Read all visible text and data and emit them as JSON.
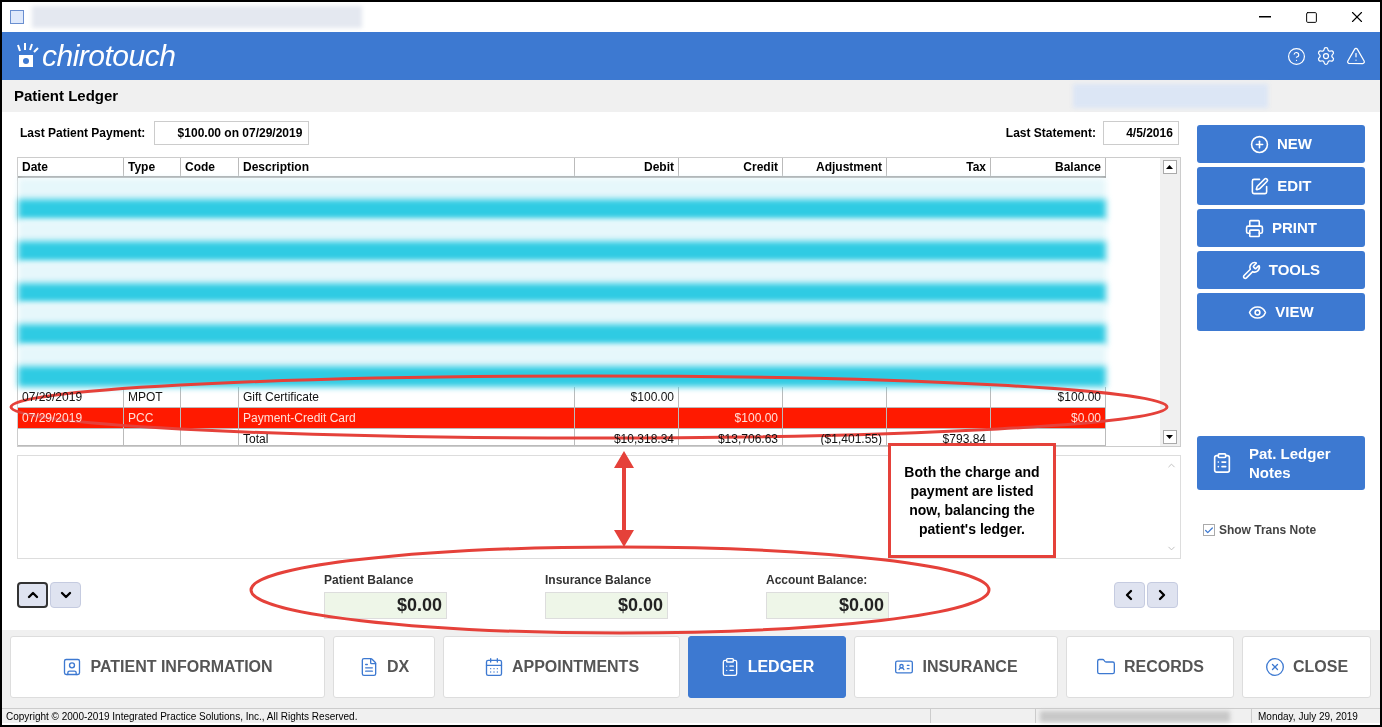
{
  "header": {
    "logo": "chirotouch"
  },
  "page_title": "Patient Ledger",
  "last_patient_payment": {
    "label": "Last Patient Payment:",
    "value": "$100.00 on 07/29/2019"
  },
  "last_statement": {
    "label": "Last Statement:",
    "value": "4/5/2016"
  },
  "table": {
    "columns": [
      "Date",
      "Type",
      "Code",
      "Description",
      "Debit",
      "Credit",
      "Adjustment",
      "Tax",
      "Balance"
    ],
    "rows": [
      {
        "kind": "blurred",
        "selected": false
      },
      {
        "kind": "blurred",
        "selected": false
      },
      {
        "kind": "blurred",
        "selected": false
      },
      {
        "kind": "blurred",
        "selected": false
      },
      {
        "kind": "blurred",
        "selected": false
      },
      {
        "kind": "blurred",
        "selected": false
      },
      {
        "kind": "blurred",
        "selected": false
      },
      {
        "kind": "blurred",
        "selected": false
      },
      {
        "kind": "blurred",
        "selected": false
      },
      {
        "kind": "blurred",
        "selected": false
      },
      {
        "kind": "entry",
        "selected": false,
        "cells": [
          "07/29/2019",
          "MPOT",
          "",
          "Gift Certificate",
          "$100.00",
          "",
          "",
          "",
          "$100.00"
        ]
      },
      {
        "kind": "entry",
        "selected": true,
        "cells": [
          "07/29/2019",
          "PCC",
          "",
          "Payment-Credit Card",
          "",
          "$100.00",
          "",
          "",
          "$0.00"
        ]
      },
      {
        "kind": "total",
        "selected": false,
        "cells": [
          "",
          "",
          "",
          "Total",
          "$10,318.34",
          "$13,706.63",
          "($1,401.55)",
          "$793.84",
          ""
        ]
      }
    ]
  },
  "actions": [
    "NEW",
    "EDIT",
    "PRINT",
    "TOOLS",
    "VIEW"
  ],
  "notes_button": "Pat. Ledger Notes",
  "show_trans_note": {
    "label": "Show Trans Note",
    "checked": true
  },
  "balances": [
    {
      "label": "Patient Balance",
      "value": "$0.00"
    },
    {
      "label": "Insurance Balance",
      "value": "$0.00"
    },
    {
      "label": "Account Balance:",
      "value": "$0.00"
    }
  ],
  "callout": "Both the charge and payment are listed now, balancing the patient's ledger.",
  "bottom_tabs": [
    {
      "label": "PATIENT INFORMATION",
      "selected": false
    },
    {
      "label": "DX",
      "selected": false
    },
    {
      "label": "APPOINTMENTS",
      "selected": false
    },
    {
      "label": "LEDGER",
      "selected": true
    },
    {
      "label": "INSURANCE",
      "selected": false
    },
    {
      "label": "RECORDS",
      "selected": false
    },
    {
      "label": "CLOSE",
      "selected": false
    }
  ],
  "status_bar": {
    "copyright": "Copyright © 2000-2019 Integrated Practice Solutions, Inc., All Rights Reserved.",
    "date": "Monday, July 29, 2019"
  }
}
